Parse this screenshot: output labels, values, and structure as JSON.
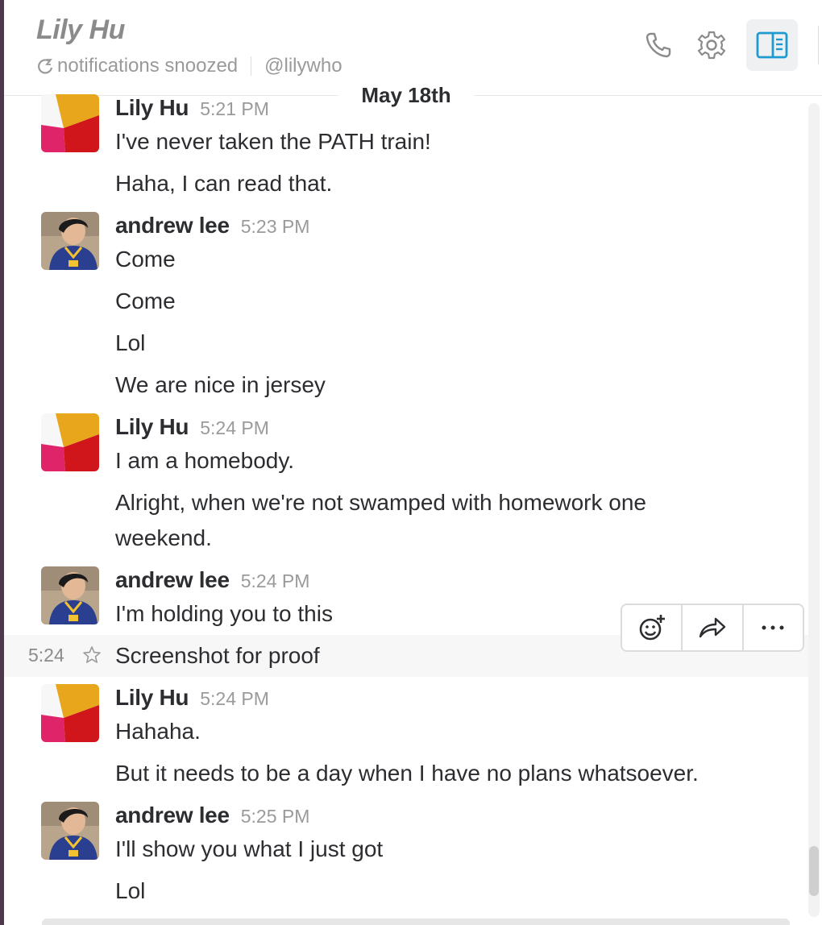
{
  "header": {
    "title": "Lily Hu",
    "status": "notifications snoozed",
    "handle": "@lilywho",
    "icons": [
      "snooze-icon",
      "phone-icon",
      "gear-icon",
      "sidebar-toggle-icon"
    ]
  },
  "date_divider": "May 18th",
  "messages": [
    {
      "sender": "Lily Hu",
      "time": "5:21 PM",
      "avatar": "lily-avatar",
      "lines": [
        "I've never taken the PATH train!",
        "Haha, I can read that."
      ]
    },
    {
      "sender": "andrew lee",
      "time": "5:23 PM",
      "avatar": "andrew-avatar",
      "lines": [
        "Come",
        "Come",
        "Lol",
        "We are nice in jersey"
      ]
    },
    {
      "sender": "Lily Hu",
      "time": "5:24 PM",
      "avatar": "lily-avatar",
      "lines": [
        "I am a homebody.",
        "Alright, when we're not swamped with homework one weekend."
      ]
    },
    {
      "sender": "andrew lee",
      "time": "5:24 PM",
      "avatar": "andrew-avatar",
      "lines": [
        "I'm holding you to this",
        "Screenshot for proof"
      ]
    },
    {
      "sender": "Lily Hu",
      "time": "5:24 PM",
      "avatar": "lily-avatar",
      "lines": [
        "Hahaha.",
        "But it needs to be a day when I have no plans whatsoever."
      ]
    },
    {
      "sender": "andrew lee",
      "time": "5:25 PM",
      "avatar": "andrew-avatar",
      "lines": [
        "I'll show you what I just got",
        "Lol"
      ]
    }
  ],
  "hovered_message": {
    "short_time": "5:24"
  },
  "message_actions": [
    "add-reaction-icon",
    "share-icon",
    "more-actions-icon"
  ],
  "colors": {
    "sidebar_edge": "#4d394b",
    "text": "#2c2d30",
    "muted": "#9a9a9a",
    "active_button": "#1d9bd1",
    "lily_yellow": "#e8a61c",
    "lily_red": "#d0161b",
    "lily_pink": "#e0246a"
  }
}
